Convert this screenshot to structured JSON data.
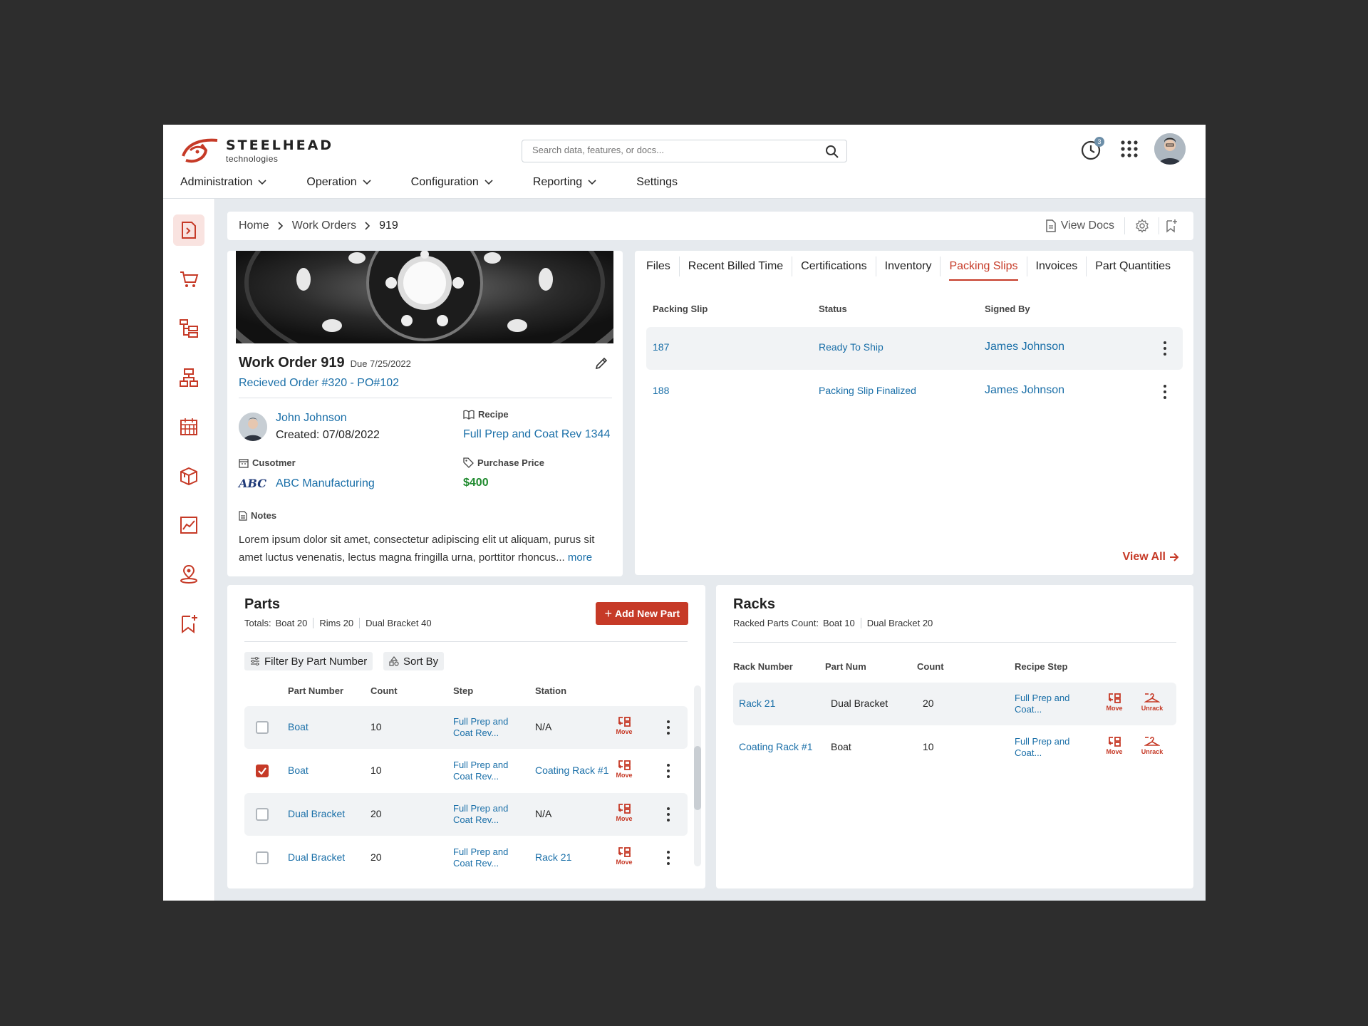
{
  "brand": {
    "name": "STEELHEAD",
    "sub": "technologies",
    "color": "#c63a27"
  },
  "search": {
    "placeholder": "Search data, features, or docs..."
  },
  "notifications": {
    "count": "3"
  },
  "nav": [
    {
      "label": "Administration"
    },
    {
      "label": "Operation"
    },
    {
      "label": "Configuration"
    },
    {
      "label": "Reporting"
    },
    {
      "label": "Settings"
    }
  ],
  "sidebar": {
    "icons": [
      "work-order-icon",
      "cart-icon",
      "hierarchy-icon",
      "flow-icon",
      "calendar-icon",
      "boxes-icon",
      "chart-icon",
      "location-icon",
      "bookmark-add-icon"
    ]
  },
  "breadcrumb": {
    "home": "Home",
    "work_orders": "Work Orders",
    "current": "919",
    "view_docs": "View Docs"
  },
  "work_order": {
    "title": "Work Order 919",
    "due": "Due 7/25/2022",
    "subtitle": "Recieved Order #320 - PO#102",
    "owner_name": "John Johnson",
    "created": "Created: 07/08/2022",
    "recipe_label": "Recipe",
    "recipe_value": "Full Prep and Coat Rev 1344",
    "customer_label": "Cusotmer",
    "customer_value": "ABC Manufacturing",
    "customer_logo": "ABC",
    "price_label": "Purchase Price",
    "price_value": "$400",
    "notes_label": "Notes",
    "notes_text": "Lorem ipsum dolor sit amet, consectetur adipiscing elit ut aliquam, purus sit amet luctus venenatis, lectus magna fringilla urna, porttitor rhoncus...",
    "notes_more": "more"
  },
  "tabs": [
    {
      "label": "Files"
    },
    {
      "label": "Recent Billed Time"
    },
    {
      "label": "Certifications"
    },
    {
      "label": "Inventory"
    },
    {
      "label": "Packing Slips",
      "active": true
    },
    {
      "label": "Invoices"
    },
    {
      "label": "Part Quantities"
    }
  ],
  "packing_slips": {
    "headers": [
      "Packing Slip",
      "Status",
      "Signed By"
    ],
    "rows": [
      {
        "slip": "187",
        "status": "Ready To Ship",
        "signed": "James Johnson"
      },
      {
        "slip": "188",
        "status": "Packing Slip Finalized",
        "signed": "James Johnson"
      }
    ],
    "view_all": "View All"
  },
  "parts": {
    "title": "Parts",
    "totals_label": "Totals:",
    "totals": [
      "Boat 20",
      "Rims 20",
      "Dual Bracket 40"
    ],
    "add_button": "Add New Part",
    "filter_label": "Filter By Part Number",
    "sort_label": "Sort By",
    "headers": [
      "Part Number",
      "Count",
      "Step",
      "Station"
    ],
    "move_label": "Move",
    "rows": [
      {
        "part": "Boat",
        "count": "10",
        "step1": "Full Prep and",
        "step2": "Coat Rev...",
        "station": "N/A",
        "station_link": false,
        "checked": false
      },
      {
        "part": "Boat",
        "count": "10",
        "step1": "Full Prep and",
        "step2": "Coat Rev...",
        "station": "Coating Rack #1",
        "station_link": true,
        "checked": true
      },
      {
        "part": "Dual Bracket",
        "count": "20",
        "step1": "Full Prep and",
        "step2": "Coat Rev...",
        "station": "N/A",
        "station_link": false,
        "checked": false
      },
      {
        "part": "Dual Bracket",
        "count": "20",
        "step1": "Full Prep and",
        "step2": "Coat Rev...",
        "station": "Rack 21",
        "station_link": true,
        "checked": false
      }
    ]
  },
  "racks": {
    "title": "Racks",
    "count_label": "Racked Parts Count:",
    "counts": [
      "Boat 10",
      "Dual Bracket 20"
    ],
    "headers": [
      "Rack Number",
      "Part Num",
      "Count",
      "Recipe Step"
    ],
    "move_label": "Move",
    "unrack_label": "Unrack",
    "rows": [
      {
        "rack": "Rack 21",
        "part": "Dual Bracket",
        "count": "20",
        "step1": "Full Prep and",
        "step2": "Coat..."
      },
      {
        "rack": "Coating Rack #1",
        "part": "Boat",
        "count": "10",
        "step1": "Full Prep and",
        "step2": "Coat..."
      }
    ]
  }
}
